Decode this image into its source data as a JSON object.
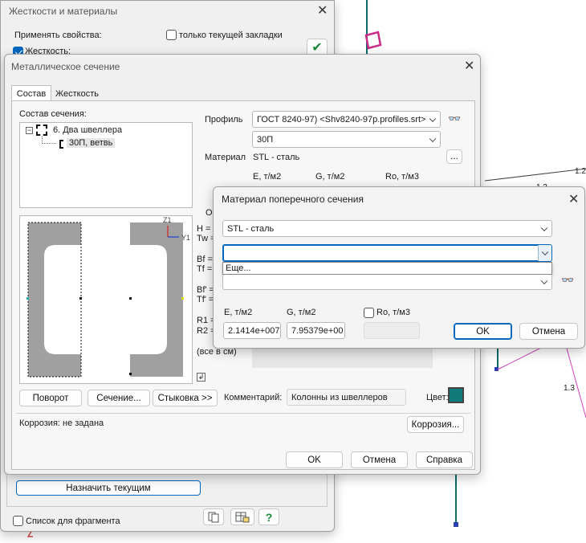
{
  "background": {
    "label_12": "1.2",
    "label_13_upper": "1.3",
    "label_13_lower": "1.3",
    "label_2": "2"
  },
  "rigidity_window": {
    "title": "Жесткости и материалы",
    "apply_label": "Применять свойства:",
    "current_tab_only_label": "только текущей закладки",
    "rigidity_label": "Жесткость:",
    "assign_current_button": "Назначить текущим",
    "fragment_list_label": "Список для фрагмента"
  },
  "section_window": {
    "title": "Металлическое сечение",
    "tabs": [
      {
        "label": "Состав"
      },
      {
        "label": "Жесткость"
      }
    ],
    "composition_label": "Состав сечения:",
    "tree": {
      "root": "6. Два швеллера",
      "child": "30П, ветвь"
    },
    "profile_label": "Профиль",
    "profile_value": "ГОСТ 8240-97) <Shv8240-97p.profiles.srt>",
    "profile_size_value": "30П",
    "material_label": "Материал",
    "material_value": "STL - сталь",
    "material_more_button": "...",
    "col_e_label": "E, т/м2",
    "col_g_label": "G, т/м2",
    "col_ro_label": "Ro, т/м3",
    "other_label": "Ог",
    "axis_z_label": "Z1",
    "axis_y_label": "Y1",
    "params": {
      "h": "H =",
      "tw": "Tw =",
      "bf": "Bf =",
      "tf": "Tf =",
      "bf2": "Bf' =",
      "tf2": "Tf' =",
      "r1": "R1 =",
      "r2": "R2 ="
    },
    "units_note": "(все в см)",
    "rotate_button": "Поворот",
    "section_button": "Сечение...",
    "joint_button": "Стыковка >>",
    "comment_label": "Комментарий:",
    "comment_value": "Колонны из швеллеров",
    "color_label": "Цвет:",
    "color_value": "#0f7a78",
    "corrosion_status": "Коррозия: не задана",
    "corrosion_button": "Коррозия...",
    "ok_button": "OK",
    "cancel_button": "Отмена",
    "help_button": "Справка"
  },
  "material_dialog": {
    "title": "Материал поперечного сечения",
    "material_select_value": "STL - сталь",
    "second_select_value": "",
    "dropdown_option": "Еще...",
    "e_label": "E, т/м2",
    "g_label": "G, т/м2",
    "ro_label": "Ro, т/м3",
    "e_value": "2.1414e+007",
    "g_value": "7.95379e+00",
    "ro_value": "",
    "ok_button": "OK",
    "cancel_button": "Отмена"
  },
  "colors": {
    "accent": "#0067c0",
    "section_fill": "#a0a0a0",
    "teal_line": "#0b6a6a",
    "magenta_line": "#cc3fb8"
  }
}
